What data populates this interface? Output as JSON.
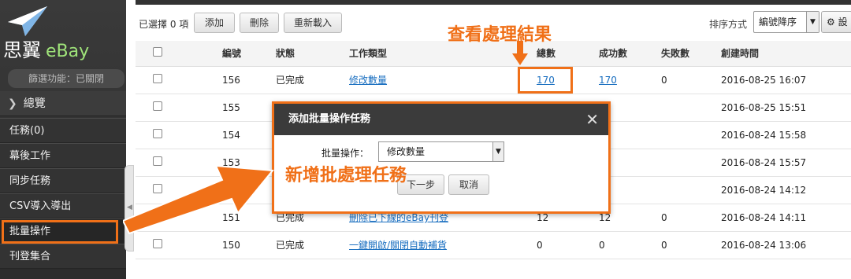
{
  "sidebar": {
    "logo_title": "思翼",
    "logo_brand": "eBay",
    "filter_status": "篩選功能：已關閉",
    "overview": "總覽",
    "items": [
      {
        "label": "任務(0)"
      },
      {
        "label": "幕後工作"
      },
      {
        "label": "同步任務"
      },
      {
        "label": "CSV導入導出"
      },
      {
        "label": "批量操作"
      },
      {
        "label": "刊登集合"
      }
    ]
  },
  "toolbar": {
    "selected_count": "已選擇 0 項",
    "add_label": "添加",
    "delete_label": "刪除",
    "reload_label": "重新載入",
    "sort_label": "排序方式",
    "sort_value": "編號降序",
    "settings_label": "設"
  },
  "table": {
    "headers": [
      "編號",
      "狀態",
      "工作類型",
      "總數",
      "成功數",
      "失敗數",
      "創建時間"
    ],
    "rows": [
      {
        "id": "156",
        "status": "已完成",
        "type": "修改數量",
        "total": "170",
        "success": "170",
        "failed": "0",
        "created": "2016-08-25 16:07"
      },
      {
        "id": "155",
        "status": "",
        "type": "",
        "total": "",
        "success": "",
        "failed": "",
        "created": "2016-08-25 15:51"
      },
      {
        "id": "154",
        "status": "",
        "type": "",
        "total": "",
        "success": "",
        "failed": "",
        "created": "2016-08-24 15:58"
      },
      {
        "id": "153",
        "status": "",
        "type": "",
        "total": "",
        "success": "",
        "failed": "",
        "created": "2016-08-24 15:57"
      },
      {
        "id": "",
        "status": "",
        "type": "",
        "total": "",
        "success": "",
        "failed": "",
        "created": "2016-08-24 14:12"
      },
      {
        "id": "151",
        "status": "已完成",
        "type": "刪除已下線的eBay刊登",
        "total": "12",
        "success": "12",
        "failed": "0",
        "created": "2016-08-24 14:11"
      },
      {
        "id": "150",
        "status": "已完成",
        "type": "一鍵開啟/關閉自動補貨",
        "total": "0",
        "success": "0",
        "failed": "0",
        "created": "2016-08-24 13:06"
      }
    ]
  },
  "annotations": {
    "view_results": "查看處理結果",
    "new_task": "新增批處理任務"
  },
  "modal": {
    "title": "添加批量操作任務",
    "field_label": "批量操作：",
    "field_value": "修改數量",
    "next_label": "下一步",
    "cancel_label": "取消"
  },
  "colors": {
    "accent": "#f07018",
    "link": "#1a6fc0",
    "sidebar": "#333333"
  }
}
